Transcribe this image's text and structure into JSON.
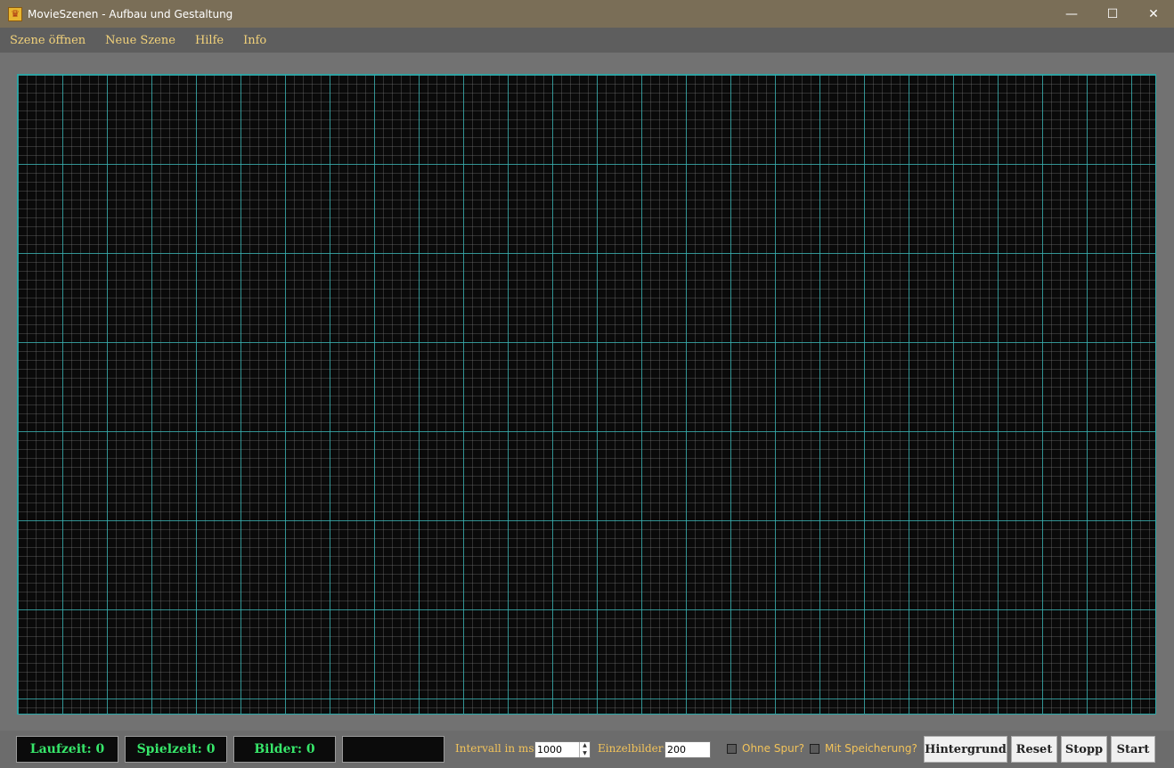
{
  "window": {
    "title": "MovieSzenen - Aufbau und Gestaltung",
    "icon": "app-scene-icon",
    "controls": {
      "minimize": "—",
      "maximize": "☐",
      "close": "✕"
    }
  },
  "menu": {
    "items": [
      {
        "label": "Szene öffnen"
      },
      {
        "label": "Neue Szene"
      },
      {
        "label": "Hilfe"
      },
      {
        "label": "Info"
      }
    ]
  },
  "status": {
    "laufzeit": "Laufzeit: 0",
    "spielzeit": "Spielzeit: 0",
    "bilder": "Bilder: 0",
    "extra": ""
  },
  "controls": {
    "intervall_label": "Intervall in ms:",
    "intervall_value": "1000",
    "einzelbilder_label": "Einzelbilder:",
    "einzelbilder_value": "200",
    "ohne_spur_label": "Ohne Spur?",
    "mit_speicherung_label": "Mit Speicherung?"
  },
  "buttons": {
    "hintergrund": "Hintergrund",
    "reset": "Reset",
    "stopp": "Stopp",
    "start": "Start"
  },
  "colors": {
    "titlebar": "#7a6e57",
    "menu_text": "#f2d27a",
    "counter_text": "#37e66a",
    "grid_major": "#32b4b4",
    "label_text": "#f2c35a"
  }
}
